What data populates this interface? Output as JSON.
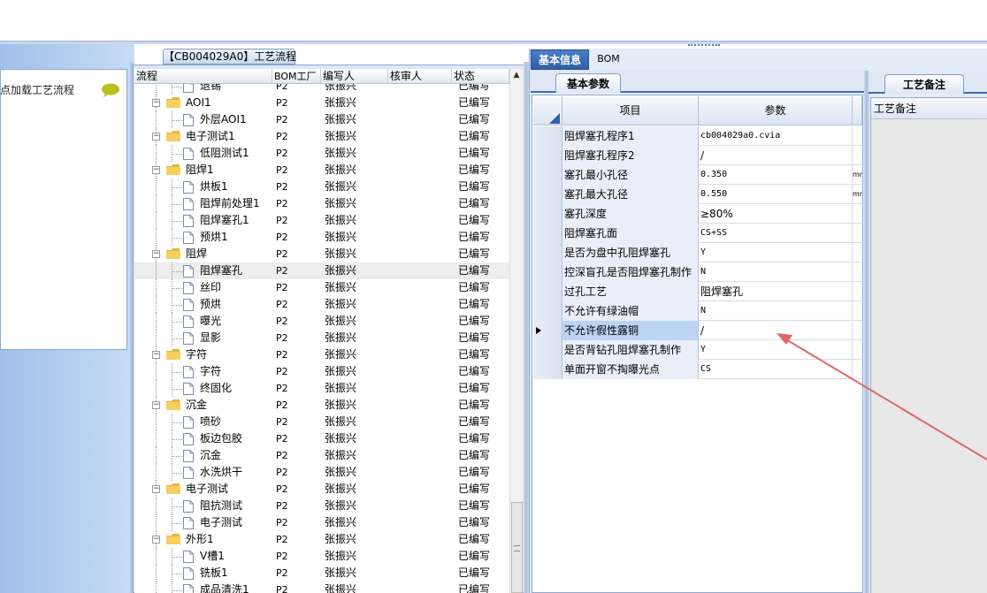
{
  "left": {
    "title": "节点加载工艺流程"
  },
  "process": {
    "panel_title": "【CB004029A0】工艺流程",
    "columns": [
      "流程",
      "BOM工厂",
      "编写人",
      "核审人",
      "状态"
    ],
    "rows": [
      {
        "name": "退锡",
        "level": 2,
        "type": "file",
        "factory": "P2",
        "writer": "张振兴",
        "reviewer": "",
        "status": "已编写"
      },
      {
        "name": "AOI1",
        "level": 1,
        "type": "folder",
        "factory": "P2",
        "writer": "张振兴",
        "reviewer": "",
        "status": "已编写"
      },
      {
        "name": "外层AOI1",
        "level": 2,
        "type": "file",
        "factory": "P2",
        "writer": "张振兴",
        "reviewer": "",
        "status": "已编写"
      },
      {
        "name": "电子测试1",
        "level": 1,
        "type": "folder",
        "factory": "P2",
        "writer": "张振兴",
        "reviewer": "",
        "status": "已编写"
      },
      {
        "name": "低阻测试1",
        "level": 2,
        "type": "file",
        "factory": "P2",
        "writer": "张振兴",
        "reviewer": "",
        "status": "已编写"
      },
      {
        "name": "阻焊1",
        "level": 1,
        "type": "folder",
        "factory": "P2",
        "writer": "张振兴",
        "reviewer": "",
        "status": "已编写"
      },
      {
        "name": "烘板1",
        "level": 2,
        "type": "file",
        "factory": "P2",
        "writer": "张振兴",
        "reviewer": "",
        "status": "已编写"
      },
      {
        "name": "阻焊前处理1",
        "level": 2,
        "type": "file",
        "factory": "P2",
        "writer": "张振兴",
        "reviewer": "",
        "status": "已编写"
      },
      {
        "name": "阻焊塞孔1",
        "level": 2,
        "type": "file",
        "factory": "P2",
        "writer": "张振兴",
        "reviewer": "",
        "status": "已编写"
      },
      {
        "name": "预烘1",
        "level": 2,
        "type": "file",
        "factory": "P2",
        "writer": "张振兴",
        "reviewer": "",
        "status": "已编写"
      },
      {
        "name": "阻焊",
        "level": 1,
        "type": "folder",
        "factory": "P2",
        "writer": "张振兴",
        "reviewer": "",
        "status": "已编写"
      },
      {
        "name": "阻焊塞孔",
        "level": 2,
        "type": "file",
        "factory": "P2",
        "writer": "张振兴",
        "reviewer": "",
        "status": "已编写",
        "selected": true
      },
      {
        "name": "丝印",
        "level": 2,
        "type": "file",
        "factory": "P2",
        "writer": "张振兴",
        "reviewer": "",
        "status": "已编写"
      },
      {
        "name": "预烘",
        "level": 2,
        "type": "file",
        "factory": "P2",
        "writer": "张振兴",
        "reviewer": "",
        "status": "已编写"
      },
      {
        "name": "曝光",
        "level": 2,
        "type": "file",
        "factory": "P2",
        "writer": "张振兴",
        "reviewer": "",
        "status": "已编写"
      },
      {
        "name": "显影",
        "level": 2,
        "type": "file",
        "factory": "P2",
        "writer": "张振兴",
        "reviewer": "",
        "status": "已编写"
      },
      {
        "name": "字符",
        "level": 1,
        "type": "folder",
        "factory": "P2",
        "writer": "张振兴",
        "reviewer": "",
        "status": "已编写"
      },
      {
        "name": "字符",
        "level": 2,
        "type": "file",
        "factory": "P2",
        "writer": "张振兴",
        "reviewer": "",
        "status": "已编写"
      },
      {
        "name": "终固化",
        "level": 2,
        "type": "file",
        "factory": "P2",
        "writer": "张振兴",
        "reviewer": "",
        "status": "已编写"
      },
      {
        "name": "沉金",
        "level": 1,
        "type": "folder",
        "factory": "P2",
        "writer": "张振兴",
        "reviewer": "",
        "status": "已编写"
      },
      {
        "name": "喷砂",
        "level": 2,
        "type": "file",
        "factory": "P2",
        "writer": "张振兴",
        "reviewer": "",
        "status": "已编写"
      },
      {
        "name": "板边包胶",
        "level": 2,
        "type": "file",
        "factory": "P2",
        "writer": "张振兴",
        "reviewer": "",
        "status": "已编写"
      },
      {
        "name": "沉金",
        "level": 2,
        "type": "file",
        "factory": "P2",
        "writer": "张振兴",
        "reviewer": "",
        "status": "已编写"
      },
      {
        "name": "水洗烘干",
        "level": 2,
        "type": "file",
        "factory": "P2",
        "writer": "张振兴",
        "reviewer": "",
        "status": "已编写"
      },
      {
        "name": "电子测试",
        "level": 1,
        "type": "folder",
        "factory": "P2",
        "writer": "张振兴",
        "reviewer": "",
        "status": "已编写"
      },
      {
        "name": "阻抗测试",
        "level": 2,
        "type": "file",
        "factory": "P2",
        "writer": "张振兴",
        "reviewer": "",
        "status": "已编写"
      },
      {
        "name": "电子测试",
        "level": 2,
        "type": "file",
        "factory": "P2",
        "writer": "张振兴",
        "reviewer": "",
        "status": "已编写"
      },
      {
        "name": "外形1",
        "level": 1,
        "type": "folder",
        "factory": "P2",
        "writer": "张振兴",
        "reviewer": "",
        "status": "已编写"
      },
      {
        "name": "V槽1",
        "level": 2,
        "type": "file",
        "factory": "P2",
        "writer": "张振兴",
        "reviewer": "",
        "status": "已编写"
      },
      {
        "name": "铣板1",
        "level": 2,
        "type": "file",
        "factory": "P2",
        "writer": "张振兴",
        "reviewer": "",
        "status": "已编写"
      },
      {
        "name": "成品清洗1",
        "level": 2,
        "type": "file",
        "factory": "P2",
        "writer": "张振兴",
        "reviewer": "",
        "status": "已编写"
      }
    ]
  },
  "right": {
    "tabs": [
      "基本信息",
      "BOM"
    ],
    "subtab": "基本参数",
    "grid_columns": [
      "项目",
      "参数"
    ],
    "rows": [
      {
        "item": "阻焊塞孔程序1",
        "value": "cb004029a0.cvia",
        "unit": "",
        "mono": true
      },
      {
        "item": "阻焊塞孔程序2",
        "value": "/",
        "unit": ""
      },
      {
        "item": "塞孔最小孔径",
        "value": "0.350",
        "unit": "mm",
        "mono": true
      },
      {
        "item": "塞孔最大孔径",
        "value": "0.550",
        "unit": "mm",
        "mono": true
      },
      {
        "item": "塞孔深度",
        "value": "≥80%",
        "unit": ""
      },
      {
        "item": "阻焊塞孔面",
        "value": "CS+SS",
        "unit": "",
        "mono": true
      },
      {
        "item": "是否为盘中孔阻焊塞孔",
        "value": "Y",
        "unit": "",
        "mono": true
      },
      {
        "item": "控深盲孔是否阻焊塞孔制作",
        "value": "N",
        "unit": "",
        "mono": true
      },
      {
        "item": "过孔工艺",
        "value": "阻焊塞孔",
        "unit": ""
      },
      {
        "item": "不允许有绿油帽",
        "value": "N",
        "unit": "",
        "mono": true
      },
      {
        "item": "不允许假性露铜",
        "value": "/",
        "unit": "",
        "selected": true
      },
      {
        "item": "是否背钻孔阻焊塞孔制作",
        "value": "Y",
        "unit": "",
        "mono": true
      },
      {
        "item": "单面开窗不掏曝光点",
        "value": "CS",
        "unit": "",
        "mono": true
      }
    ],
    "notes_tab": "工艺备注",
    "notes_header": "工艺备注"
  },
  "colors": {
    "accent_blue": "#2f5fa8",
    "annotation_arrow": "#e06666"
  }
}
